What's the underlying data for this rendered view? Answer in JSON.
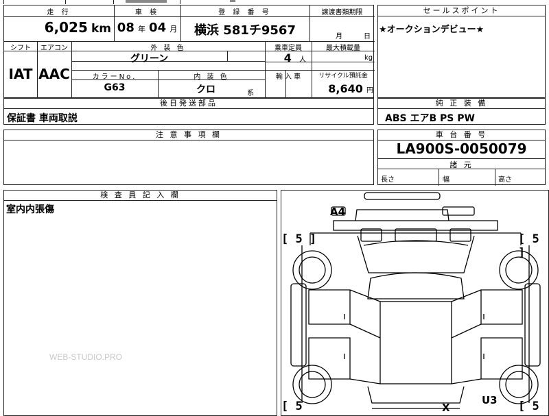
{
  "top_table": {
    "headers": {
      "mileage": "走 行",
      "inspection": "車 検",
      "registration": "登 録 番 号",
      "transfer_deadline": "譲渡書類期限",
      "shift": "シフト",
      "aircon": "エアコン",
      "exterior_color": "外 装 色",
      "capacity": "乗車定員",
      "max_load": "最大積載量",
      "color_no": "カラーNo.",
      "interior_color": "内 装 色",
      "import": "輸 入 車",
      "recycle": "リサイクル預託金"
    },
    "mileage_value": "6,025",
    "mileage_unit": "km",
    "inspection_year": "08",
    "year_unit": "年",
    "inspection_month": "04",
    "month_unit": "月",
    "registration_number": "横浜 581チ9567",
    "transfer_month_unit": "月",
    "transfer_day_unit": "日",
    "shift_value": "IAT",
    "aircon_value": "AAC",
    "exterior_color_value": "グリーン",
    "capacity_value": "4",
    "capacity_unit": "人",
    "load_unit": "kg",
    "color_no_value": "G63",
    "interior_color_value": "クロ",
    "interior_suffix": "系",
    "recycle_value": "8,640",
    "recycle_unit": "円"
  },
  "selling_points": {
    "header": "セールスポイント",
    "text": "★オークションデビュー★"
  },
  "later_parts": {
    "header": "後日発送部品",
    "text": "保証書 車両取説"
  },
  "standard_equipment": {
    "header": "純 正 装 備",
    "text": "ABS エアB PS PW"
  },
  "notes": {
    "header": "注 意 事 項 欄"
  },
  "chassis": {
    "header": "車 台 番 号",
    "value": "LA900S-0050079",
    "specs_header": "諸 元",
    "length": "長さ",
    "width": "幅",
    "height": "高さ"
  },
  "inspector": {
    "header": "検 査 員 記 入 欄",
    "text": "室内内張傷"
  },
  "diagram": {
    "marks": {
      "a4": "A4",
      "u3": "U3",
      "x": "X",
      "tire_fl": "[ 5 ]",
      "tire_fr": "[ 5 ]",
      "tire_rl": "[ 5",
      "tire_rr": "[ 5"
    }
  },
  "watermark": "WEB-STUDIO.PRO"
}
